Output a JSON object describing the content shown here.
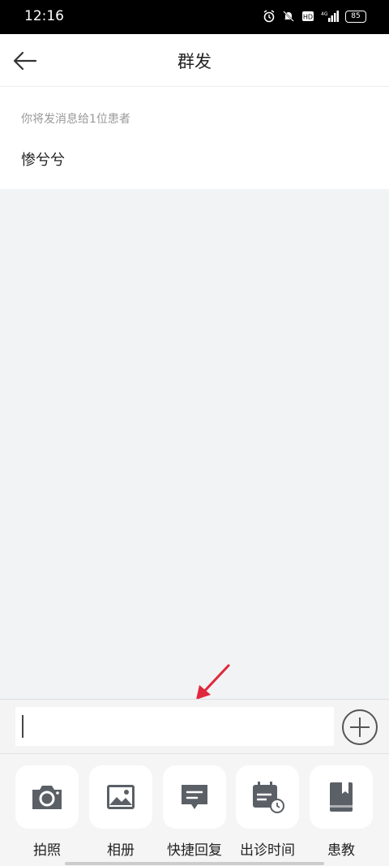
{
  "status_bar": {
    "time": "12:16",
    "battery": "85"
  },
  "header": {
    "title": "群发"
  },
  "recipients": {
    "hint": "你将发消息给1位患者",
    "name": "惨兮兮"
  },
  "input": {
    "value": "",
    "placeholder": ""
  },
  "toolbar": {
    "items": [
      {
        "label": "拍照",
        "icon": "camera-icon"
      },
      {
        "label": "相册",
        "icon": "image-icon"
      },
      {
        "label": "快捷回复",
        "icon": "message-icon"
      },
      {
        "label": "出诊时间",
        "icon": "calendar-clock-icon"
      },
      {
        "label": "患教",
        "icon": "book-icon"
      }
    ]
  },
  "colors": {
    "accent_arrow": "#e0283c",
    "icon_gray": "#5b5f66",
    "background": "#f2f3f5"
  }
}
